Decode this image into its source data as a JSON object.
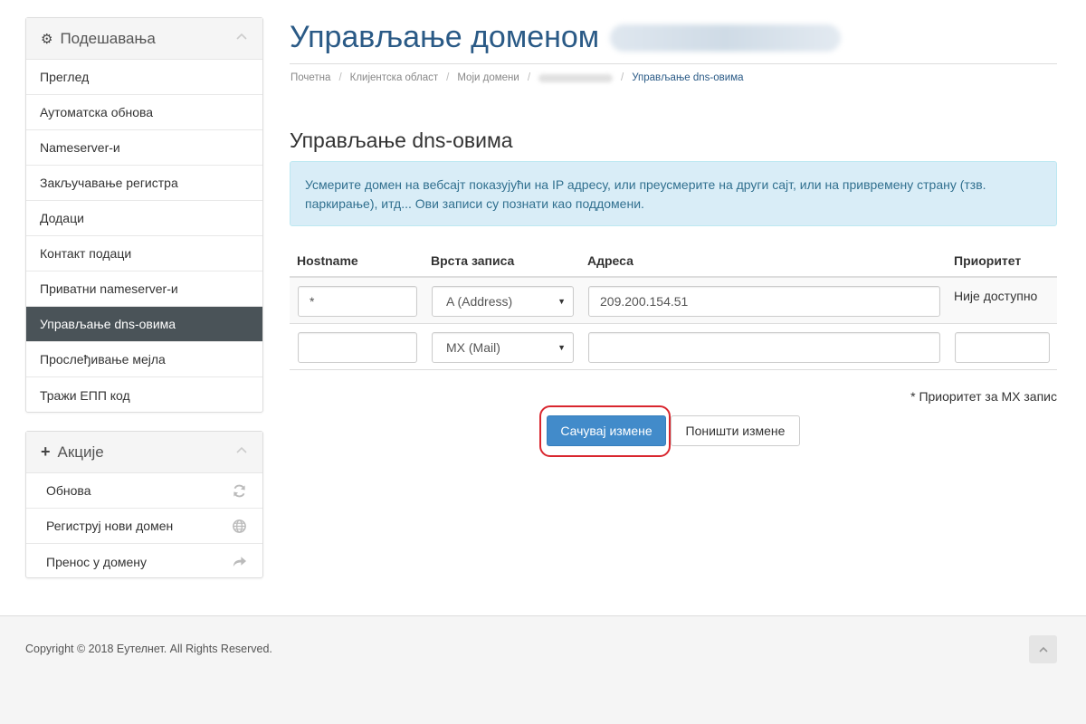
{
  "sidebar": {
    "settings": {
      "title": "Подешавања",
      "items": [
        {
          "label": "Преглед"
        },
        {
          "label": "Аутоматска обнова"
        },
        {
          "label": "Nameserver-и"
        },
        {
          "label": "Закључавање регистра"
        },
        {
          "label": "Додаци"
        },
        {
          "label": "Контакт подаци"
        },
        {
          "label": "Приватни nameserver-и"
        },
        {
          "label": "Управљање dns-овима",
          "active": true
        },
        {
          "label": "Прослеђивање мејла"
        },
        {
          "label": "Тражи ЕПП код"
        }
      ]
    },
    "actions": {
      "title": "Акције",
      "items": [
        {
          "label": "Обнова",
          "icon": "refresh-icon"
        },
        {
          "label": "Региструј нови домен",
          "icon": "globe-icon"
        },
        {
          "label": "Пренос у домену",
          "icon": "share-arrow-icon"
        }
      ]
    }
  },
  "header": {
    "title": "Управљање доменом"
  },
  "breadcrumb": {
    "home": "Почетна",
    "client_area": "Клијентска област",
    "my_domains": "Моји домени",
    "current": "Управљање dns-овима"
  },
  "main": {
    "section_title": "Управљање dns-овима",
    "alert": "Усмерите домен на вебсајт показујући на IP адресу, или преусмерите на други сајт, или на привремену страну (тзв. паркирање), итд... Ови записи су познати као поддомени.",
    "table": {
      "headers": [
        "Hostname",
        "Врста записа",
        "Адреса",
        "Приоритет"
      ],
      "rows": [
        {
          "hostname": "*",
          "type": "A (Address)",
          "address": "209.200.154.51",
          "priority": "Није доступно"
        },
        {
          "hostname": "",
          "type": "MX (Mail)",
          "address": "",
          "priority": ""
        }
      ]
    },
    "note": "* Приоритет за MX запис",
    "save_label": "Сачувај измене",
    "cancel_label": "Поништи измене"
  },
  "footer": {
    "copyright": "Copyright © 2018 Еутелнет. All Rights Reserved."
  },
  "colors": {
    "title": "#2a5a86",
    "active_menu": "#4a5358",
    "primary_button": "#428bca",
    "alert_bg": "#d9edf7",
    "highlight": "#d9262e"
  }
}
